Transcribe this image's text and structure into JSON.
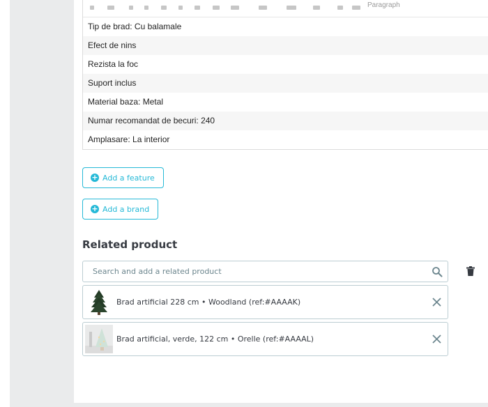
{
  "editor": {
    "toolbar_text": "Paragraph",
    "features": [
      "Tip de brad: Cu balamale",
      "Efect de nins",
      "Rezista la foc",
      "Suport inclus",
      "Material baza: Metal",
      "Numar recomandat de becuri: 240",
      "Amplasare: La interior"
    ]
  },
  "buttons": {
    "add_feature": "Add a feature",
    "add_brand": "Add a brand"
  },
  "related": {
    "title": "Related product",
    "search_placeholder": "Search and add a related product",
    "items": [
      {
        "name": "Brad artificial 228 cm • Woodland (ref:#AAAAK)",
        "icon": "christmas-tree-thumbnail"
      },
      {
        "name": "Brad artificial, verde, 122 cm • Orelle (ref:#AAAAL)",
        "icon": "decorated-tree-thumbnail"
      }
    ]
  },
  "colors": {
    "accent": "#25b9d7",
    "title": "#363a41",
    "border": "#bbcdd2",
    "page_bg": "#eaebec"
  }
}
